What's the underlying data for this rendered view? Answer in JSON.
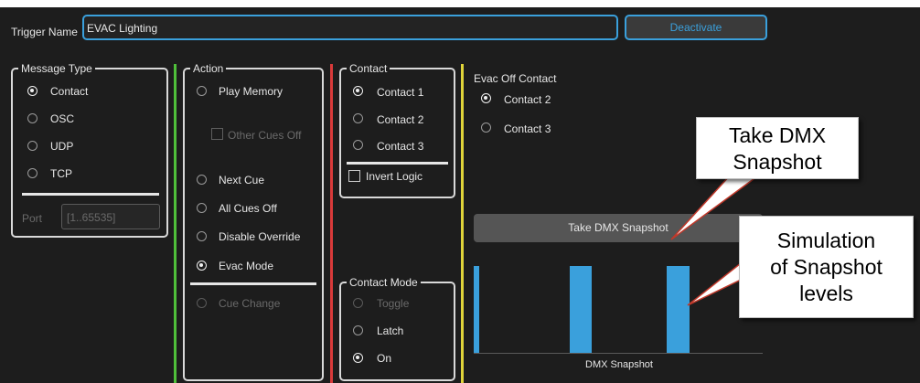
{
  "header": {
    "trigger_name_label": "Trigger Name",
    "trigger_name_value": "EVAC Lighting",
    "deactivate_label": "Deactivate"
  },
  "message_type": {
    "legend": "Message Type",
    "options": [
      {
        "label": "Contact",
        "selected": true
      },
      {
        "label": "OSC",
        "selected": false
      },
      {
        "label": "UDP",
        "selected": false
      },
      {
        "label": "TCP",
        "selected": false
      }
    ],
    "port_label": "Port",
    "port_placeholder": "[1..65535]"
  },
  "action": {
    "legend": "Action",
    "play_memory": "Play Memory",
    "other_cues_off": "Other Cues Off",
    "next_cue": "Next Cue",
    "all_cues_off": "All Cues Off",
    "disable_override": "Disable Override",
    "evac_mode": "Evac Mode",
    "cue_change": "Cue Change",
    "selected": "Evac Mode"
  },
  "contact": {
    "legend": "Contact",
    "options": [
      {
        "label": "Contact 1",
        "selected": true
      },
      {
        "label": "Contact 2",
        "selected": false
      },
      {
        "label": "Contact 3",
        "selected": false
      }
    ],
    "invert_logic": "Invert Logic"
  },
  "contact_mode": {
    "legend": "Contact Mode",
    "options": [
      {
        "label": "Toggle",
        "selected": false,
        "disabled": true
      },
      {
        "label": "Latch",
        "selected": false,
        "disabled": false
      },
      {
        "label": "On",
        "selected": true,
        "disabled": false
      }
    ]
  },
  "evac_off": {
    "title": "Evac Off Contact",
    "options": [
      {
        "label": "Contact 2",
        "selected": true
      },
      {
        "label": "Contact 3",
        "selected": false
      }
    ]
  },
  "snapshot": {
    "button_label": "Take DMX Snapshot",
    "chart_label": "DMX Snapshot"
  },
  "callouts": {
    "take_dmx_line1": "Take DMX",
    "take_dmx_line2": "Snapshot",
    "sim_line1": "Simulation",
    "sim_line2": "of Snapshot",
    "sim_line3": "levels"
  },
  "colors": {
    "background": "#1d1d1d",
    "accent_blue": "#3aa0dc",
    "divider_green": "#4fbf3a",
    "divider_red": "#d93a3a",
    "divider_yellow": "#e0d43a",
    "callout_pointer": "#c0392b"
  }
}
